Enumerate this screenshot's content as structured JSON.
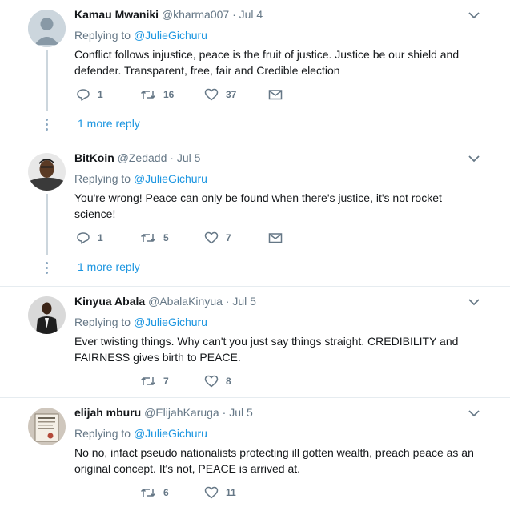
{
  "tweets": [
    {
      "name": "Kamau Mwaniki",
      "handle": "@kharma007",
      "date": "Jul 4",
      "reply_prefix": "Replying to",
      "reply_user": "@JulieGichuru",
      "text": "Conflict follows injustice, peace is the fruit of justice. Justice be our shield and defender. Transparent, free, fair and Credible election",
      "replies": "1",
      "retweets": "16",
      "likes": "37",
      "more": "1 more reply"
    },
    {
      "name": "BitKoin",
      "handle": "@Zedadd",
      "date": "Jul 5",
      "reply_prefix": "Replying to",
      "reply_user": "@JulieGichuru",
      "text": "You're wrong! Peace can only be found when there's justice, it's not rocket science!",
      "replies": "1",
      "retweets": "5",
      "likes": "7",
      "more": "1 more reply"
    },
    {
      "name": "Kinyua Abala",
      "handle": "@AbalaKinyua",
      "date": "Jul 5",
      "reply_prefix": "Replying to",
      "reply_user": "@JulieGichuru",
      "text": "Ever twisting things. Why can't you just say things straight. CREDIBILITY and FAIRNESS gives birth to PEACE.",
      "replies": "",
      "retweets": "7",
      "likes": "8"
    },
    {
      "name": "elijah mburu",
      "handle": "@ElijahKaruga",
      "date": "Jul 5",
      "reply_prefix": "Replying to",
      "reply_user": "@JulieGichuru",
      "text": "No no, infact pseudo nationalists protecting ill gotten wealth, preach peace as an original concept. It's not, PEACE is arrived at.",
      "replies": "",
      "retweets": "6",
      "likes": "11"
    }
  ],
  "colors": {
    "link": "#1b95e0",
    "muted": "#657786",
    "divider": "#e6ecf0"
  },
  "icons": [
    "reply-icon",
    "retweet-icon",
    "heart-icon",
    "message-icon",
    "chevron-down-icon"
  ]
}
